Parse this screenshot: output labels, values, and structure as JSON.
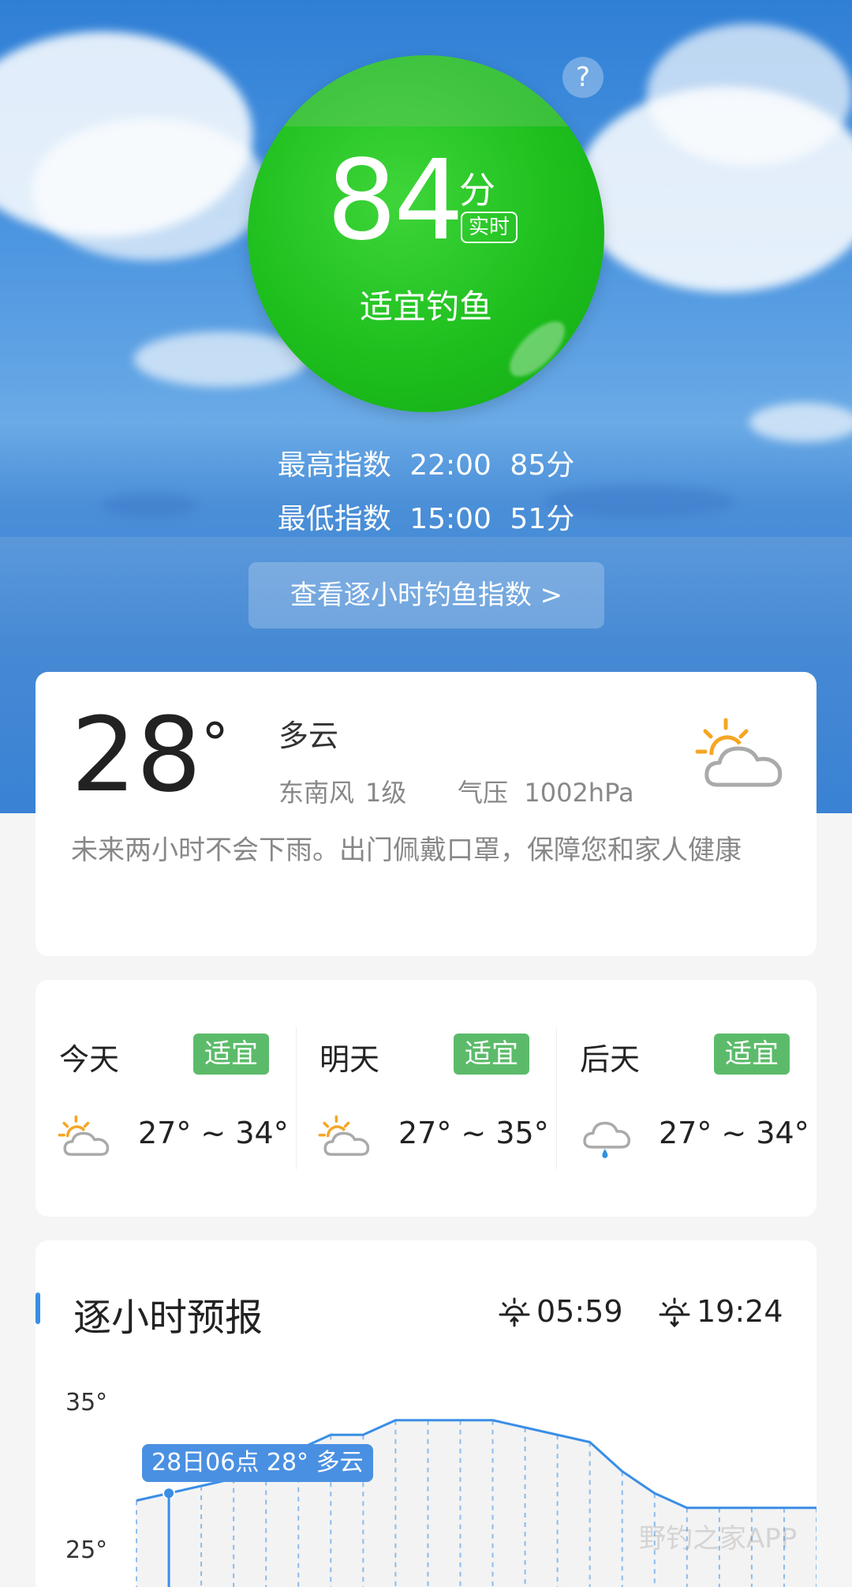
{
  "score": {
    "value": "84",
    "unit": "分",
    "tag": "实时",
    "description": "适宜钓鱼",
    "color": "#1dbf1d"
  },
  "help_icon": "question-circle-icon",
  "help_label": "?",
  "index_high": {
    "label": "最高指数",
    "time": "22:00",
    "score": "85分"
  },
  "index_low": {
    "label": "最低指数",
    "time": "15:00",
    "score": "51分"
  },
  "hourly_link": "查看逐小时钓鱼指数 >",
  "current": {
    "temp": "28",
    "deg": "°",
    "condition": "多云",
    "wind_dir": "东南风",
    "wind_level": "1级",
    "pressure_label": "气压",
    "pressure_value": "1002hPa",
    "icon": "partly-cloudy-icon",
    "tip": "未来两小时不会下雨。出门佩戴口罩，保障您和家人健康"
  },
  "forecast": [
    {
      "day": "今天",
      "badge": "适宜",
      "temp": "27° ~ 34°",
      "icon": "partly-cloudy-icon"
    },
    {
      "day": "明天",
      "badge": "适宜",
      "temp": "27° ~ 35°",
      "icon": "partly-cloudy-icon"
    },
    {
      "day": "后天",
      "badge": "适宜",
      "temp": "27° ~ 34°",
      "icon": "rain-cloud-icon"
    }
  ],
  "badge_color": "#5cbb6a",
  "hourly": {
    "title": "逐小时预报",
    "sunrise": "05:59",
    "sunset": "19:24",
    "tooltip": "28日06点 28° 多云",
    "watermark": "野钓之家APP"
  },
  "chart_data": {
    "type": "line",
    "ylabels": [
      "35°",
      "25°"
    ],
    "ylim": [
      25,
      35
    ],
    "series": [
      {
        "values": [
          28,
          28.5,
          29,
          29.5,
          30,
          31.5,
          32.5,
          32.5,
          33.5,
          33.5,
          33.5,
          33.5,
          33,
          32.5,
          32,
          30,
          28.5,
          27.5,
          27.5,
          27.5,
          27.5,
          27.5
        ]
      }
    ],
    "accent": "#3a8ee6"
  }
}
